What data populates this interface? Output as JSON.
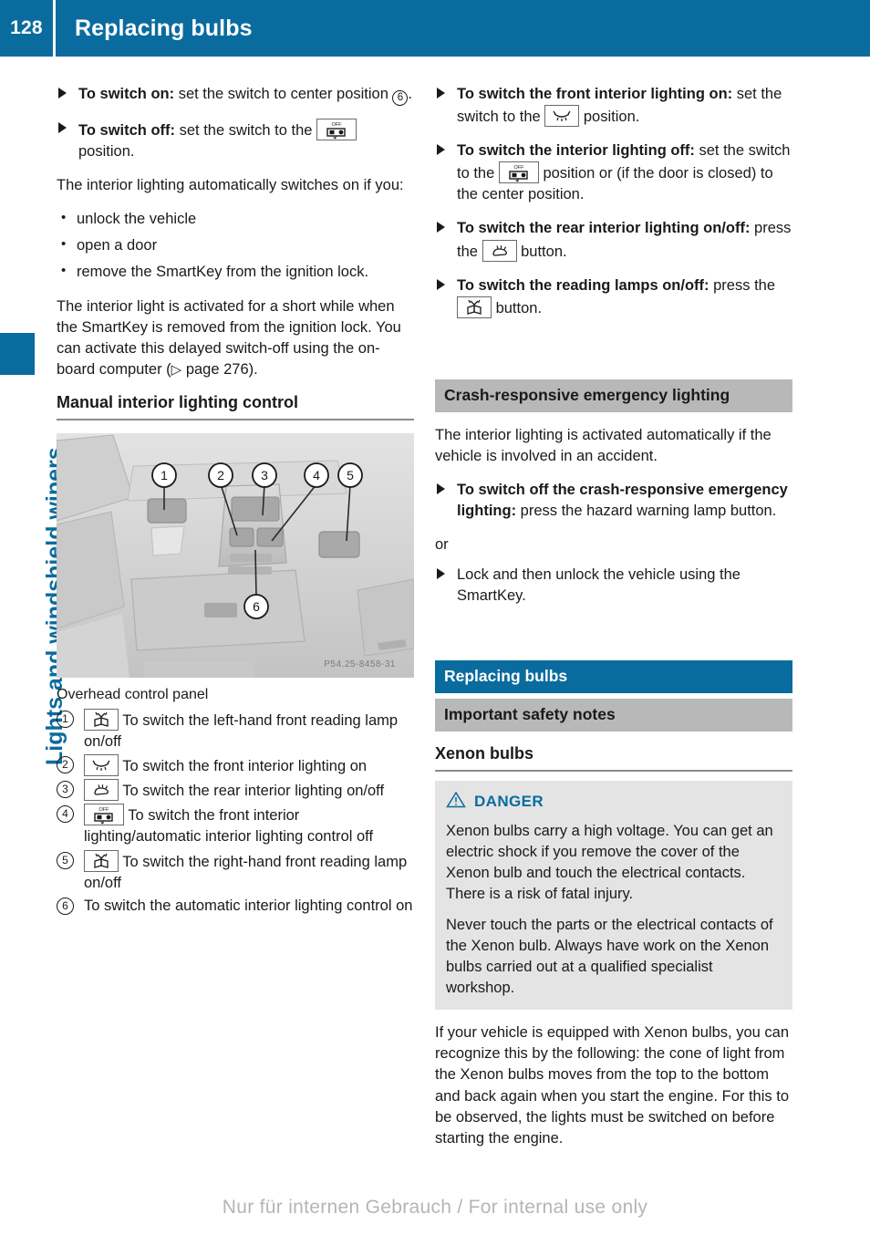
{
  "header": {
    "page_number": "128",
    "title": "Replacing bulbs",
    "bg_color": "#0a6b9e"
  },
  "side_tab": {
    "label": "Lights and windshield wipers",
    "color": "#0a6b9e"
  },
  "left_column": {
    "steps": [
      {
        "bold": "To switch on:",
        "text_before_icon": " set the switch to center position ",
        "circled_ref": "6",
        "text_after": "."
      },
      {
        "bold": "To switch off:",
        "text_before_icon": " set the switch to the ",
        "icon": "car-off-icon",
        "text_after": " position."
      }
    ],
    "intro_paragraph": "The interior lighting automatically switches on if you:",
    "bullets": [
      "unlock the vehicle",
      "open a door",
      "remove the SmartKey from the ignition lock."
    ],
    "delay_paragraph_1": "The interior light is activated for a short while when the SmartKey is removed from the ignition lock. You can activate this delayed switch-off using the on-board computer",
    "delay_paragraph_ref": "page 276",
    "section_heading": "Manual interior lighting control",
    "figure": {
      "caption": "Overhead control panel",
      "part_number": "P54.25-8458-31",
      "callouts": [
        "1",
        "2",
        "3",
        "4",
        "5",
        "6"
      ]
    },
    "legend": [
      {
        "num": "1",
        "icon": "reading-lamp-icon",
        "text": "To switch the left-hand front reading lamp on/off"
      },
      {
        "num": "2",
        "icon": "dome-lamp-icon",
        "text": "To switch the front interior lighting on"
      },
      {
        "num": "3",
        "icon": "rear-lamp-icon",
        "text": "To switch the rear interior lighting on/off"
      },
      {
        "num": "4",
        "icon": "car-off-icon",
        "text": "To switch the front interior lighting/automatic interior lighting control off"
      },
      {
        "num": "5",
        "icon": "reading-lamp-icon",
        "text": "To switch the right-hand front reading lamp on/off"
      },
      {
        "num": "6",
        "icon": "",
        "text": "To switch the automatic interior lighting control on"
      }
    ]
  },
  "right_column": {
    "steps": [
      {
        "bold": "To switch the front interior lighting on:",
        "text_before_icon": " set the switch to the ",
        "icon": "dome-lamp-icon",
        "text_after": " position."
      },
      {
        "bold": "To switch the interior lighting off:",
        "text_before_icon": " set the switch to the ",
        "icon": "car-off-icon",
        "text_after": " position or (if the door is closed) to the center position."
      },
      {
        "bold": "To switch the rear interior lighting on/off:",
        "text_before_icon": " press the ",
        "icon": "rear-lamp-icon",
        "text_after": " button."
      },
      {
        "bold": "To switch the reading lamps on/off:",
        "text_before_icon": " press the ",
        "icon": "reading-lamp-icon",
        "text_after": " button."
      }
    ],
    "crash_section": {
      "heading": "Crash-responsive emergency lighting",
      "paragraph": "The interior lighting is activated automatically if the vehicle is involved in an accident.",
      "step_bold": "To switch off the crash-responsive emergency lighting:",
      "step_text": " press the hazard warning lamp button.",
      "or_label": "or",
      "step2_text": "Lock and then unlock the vehicle using the SmartKey."
    },
    "replacing_section": {
      "band_blue": "Replacing bulbs",
      "band_gray": "Important safety notes",
      "sub_heading": "Xenon bulbs",
      "danger": {
        "label": "DANGER",
        "icon": "warning-triangle-icon",
        "color": "#0a6b9e",
        "paragraph_1": "Xenon bulbs carry a high voltage. You can get an electric shock if you remove the cover of the Xenon bulb and touch the electrical contacts. There is a risk of fatal injury.",
        "paragraph_2": "Never touch the parts or the electrical contacts of the Xenon bulb. Always have work on the Xenon bulbs carried out at a qualified specialist workshop."
      },
      "closing_paragraph": "If your vehicle is equipped with Xenon bulbs, you can recognize this by the following: the cone of light from the Xenon bulbs moves from the top to the bottom and back again when you start the engine. For this to be observed, the lights must be switched on before starting the engine."
    }
  },
  "footer": {
    "watermark": "Nur für internen Gebrauch / For internal use only"
  }
}
